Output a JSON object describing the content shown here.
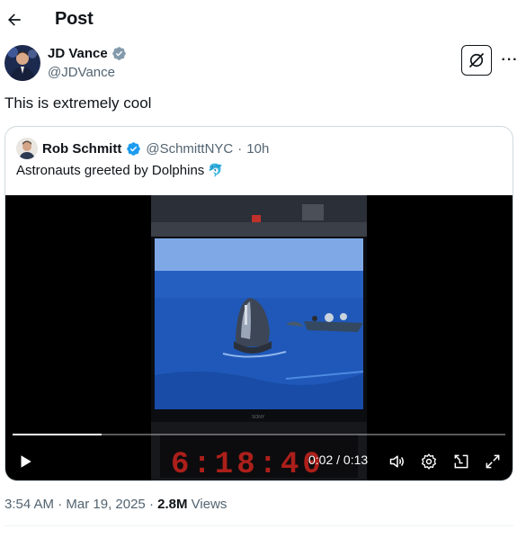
{
  "header": {
    "title": "Post",
    "back_icon": "arrow-left-icon"
  },
  "author": {
    "name": "JD Vance",
    "handle": "@JDVance",
    "verified_color": "#829aab",
    "grok_icon": "grok-icon",
    "more_label": "···"
  },
  "post": {
    "text": "This is extremely cool"
  },
  "quote": {
    "name": "Rob Schmitt",
    "handle": "@SchmittNYC",
    "separator": "·",
    "age": "10h",
    "verified_color": "#1d9bf0",
    "text": "Astronauts greeted by Dolphins",
    "emoji": "🐬"
  },
  "video": {
    "time": "0:02 / 0:13",
    "progress": 0.18,
    "clock_text": "6:18:40",
    "screen_brand": "SONY",
    "controls": [
      "play-icon",
      "volume-icon",
      "settings-icon",
      "minimize-icon",
      "fullscreen-icon"
    ]
  },
  "meta": {
    "time": "3:54 AM",
    "dot1": "·",
    "date": "Mar 19, 2025",
    "dot2": "·",
    "views_count": "2.8M",
    "views_label": "Views"
  },
  "colors": {
    "accent": "#1d9bf0",
    "text": "#0f1419",
    "secondary": "#536471",
    "border": "#cfd9de"
  }
}
